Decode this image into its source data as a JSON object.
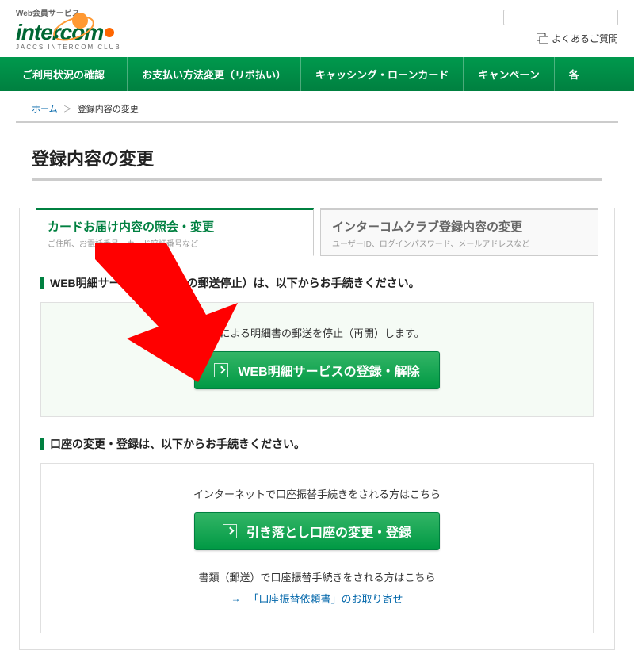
{
  "header": {
    "tagline": "Web会員サービス",
    "logo_text": "intercom",
    "logo_sub": "JACCS INTERCOM CLUB",
    "faq_label": "よくあるご質問"
  },
  "nav": {
    "items": [
      "ご利用状況の確認",
      "お支払い方法変更（リボ払い）",
      "キャッシング・ローンカード",
      "キャンペーン",
      "各"
    ]
  },
  "breadcrumb": {
    "home": "ホーム",
    "current": "登録内容の変更"
  },
  "page_title": "登録内容の変更",
  "tabs": {
    "tab1_title": "カードお届け内容の照会・変更",
    "tab1_desc": "ご住所、お電話番号、カード暗証番号など",
    "tab2_title": "インターコムクラブ登録内容の変更",
    "tab2_desc": "ユーザーID、ログインパスワード、メールアドレスなど"
  },
  "sections": {
    "web_meisai_label": "WEB明細サービス（明細書の郵送停止）は、以下からお手続きください。",
    "web_meisai_caption": "紙による明細書の郵送を停止（再開）します。",
    "web_meisai_button": "WEB明細サービスの登録・解除",
    "account_label": "口座の変更・登録は、以下からお手続きください。",
    "account_caption": "インターネットで口座振替手続きをされる方はこちら",
    "account_button": "引き落とし口座の変更・登録",
    "account_sub": "書類（郵送）で口座振替手続きをされる方はこちら",
    "account_link": "「口座振替依頼書」のお取り寄せ"
  }
}
